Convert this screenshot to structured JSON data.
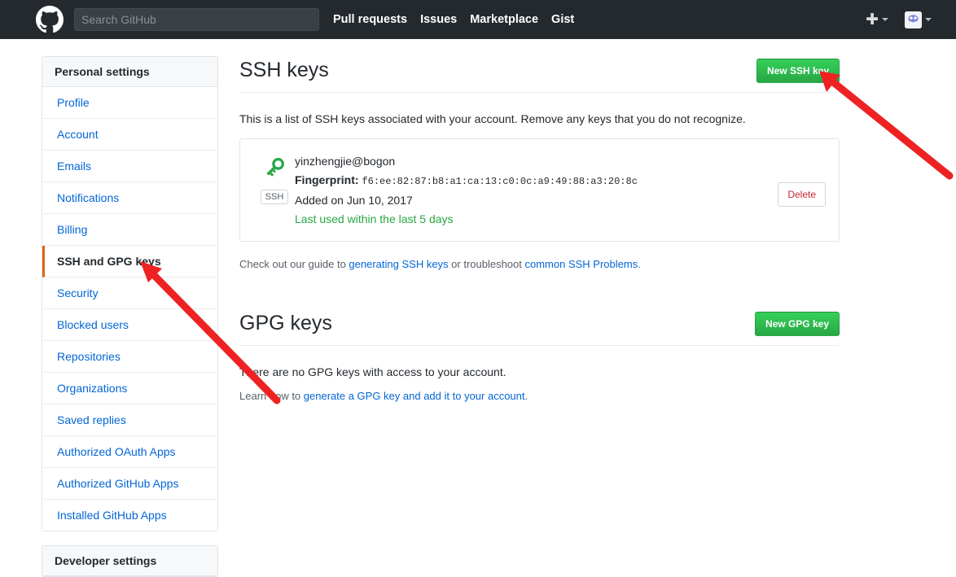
{
  "header": {
    "logo_icon": "github-logo-icon",
    "search": {
      "placeholder": "Search GitHub",
      "value": ""
    },
    "nav": [
      {
        "label": "Pull requests"
      },
      {
        "label": "Issues"
      },
      {
        "label": "Marketplace"
      },
      {
        "label": "Gist"
      }
    ],
    "create_new_icon": "plus-icon",
    "create_new_caret_icon": "chevron-down-icon",
    "avatar_icon": "user-avatar",
    "avatar_caret_icon": "chevron-down-icon"
  },
  "sidebar": {
    "personal": {
      "heading": "Personal settings",
      "items": [
        {
          "label": "Profile",
          "selected": false
        },
        {
          "label": "Account",
          "selected": false
        },
        {
          "label": "Emails",
          "selected": false
        },
        {
          "label": "Notifications",
          "selected": false
        },
        {
          "label": "Billing",
          "selected": false
        },
        {
          "label": "SSH and GPG keys",
          "selected": true
        },
        {
          "label": "Security",
          "selected": false
        },
        {
          "label": "Blocked users",
          "selected": false
        },
        {
          "label": "Repositories",
          "selected": false
        },
        {
          "label": "Organizations",
          "selected": false
        },
        {
          "label": "Saved replies",
          "selected": false
        },
        {
          "label": "Authorized OAuth Apps",
          "selected": false
        },
        {
          "label": "Authorized GitHub Apps",
          "selected": false
        },
        {
          "label": "Installed GitHub Apps",
          "selected": false
        }
      ]
    },
    "developer": {
      "heading": "Developer settings"
    }
  },
  "ssh_section": {
    "title": "SSH keys",
    "new_key_button": "New SSH key",
    "description": "This is a list of SSH keys associated with your account. Remove any keys that you do not recognize.",
    "keys": [
      {
        "icon": "key-icon",
        "badge": "SSH",
        "title": "yinzhengjie@bogon",
        "fingerprint_label": "Fingerprint:",
        "fingerprint": "f6:ee:82:87:b8:a1:ca:13:c0:0c:a9:49:88:a3:20:8c",
        "added": "Added on Jun 10, 2017",
        "last_used": "Last used within the last 5 days",
        "delete_button": "Delete"
      }
    ],
    "guide": {
      "prefix": "Check out our guide to ",
      "link1": "generating SSH keys",
      "middle": " or troubleshoot ",
      "link2": "common SSH Problems",
      "suffix": "."
    }
  },
  "gpg_section": {
    "title": "GPG keys",
    "new_key_button": "New GPG key",
    "empty_text": "There are no GPG keys with access to your account.",
    "learn": {
      "prefix": "Learn how to ",
      "link": "generate a GPG key and add it to your account",
      "suffix": "."
    }
  },
  "annotations": {
    "arrow_color": "#ee2222",
    "arrow1_target": "sidebar-item-ssh-and-gpg-keys",
    "arrow2_target": "new-ssh-key-button"
  },
  "colors": {
    "header_bg": "#24292e",
    "accent_green": "#28a745",
    "link_blue": "#0366d6",
    "selected_border": "#e36209",
    "danger_red": "#cb2431"
  }
}
